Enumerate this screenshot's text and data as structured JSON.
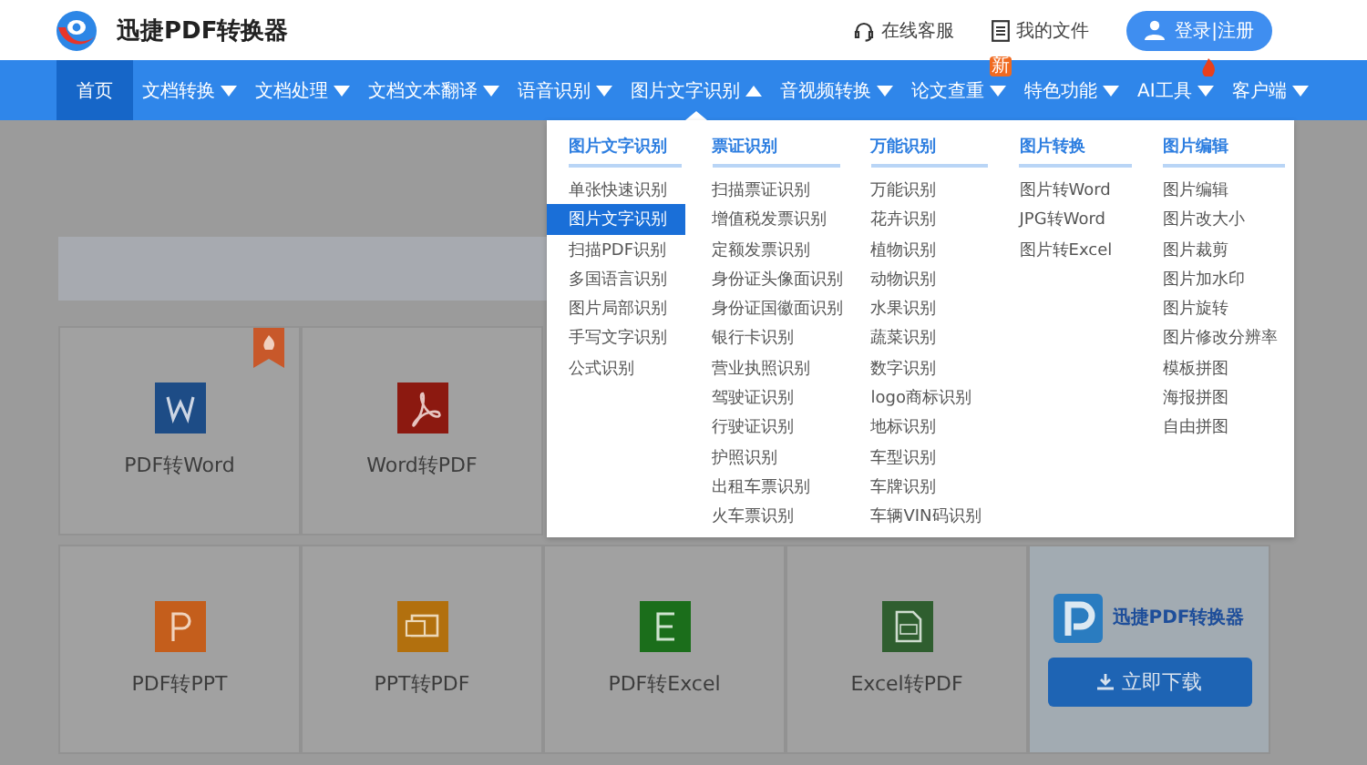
{
  "header": {
    "brand": "迅捷PDF转换器",
    "links": [
      {
        "kind": "service",
        "label": "在线客服"
      },
      {
        "kind": "files",
        "label": "我的文件"
      }
    ],
    "login": "登录|注册"
  },
  "nav": {
    "items": [
      {
        "label": "首页",
        "selected": true,
        "kind": "link",
        "expanded": false,
        "hot": false
      },
      {
        "label": "文档转换",
        "selected": false,
        "kind": "menu",
        "expanded": false,
        "hot": false
      },
      {
        "label": "文档处理",
        "selected": false,
        "kind": "menu",
        "expanded": false,
        "hot": false
      },
      {
        "label": "文档文本翻译",
        "selected": false,
        "kind": "menu",
        "expanded": false,
        "hot": false
      },
      {
        "label": "语音识别",
        "selected": false,
        "kind": "menu",
        "expanded": false,
        "hot": false
      },
      {
        "label": "图片文字识别",
        "selected": false,
        "kind": "menu",
        "expanded": true,
        "hot": false
      },
      {
        "label": "音视频转换",
        "selected": false,
        "kind": "menu",
        "expanded": false,
        "hot": false
      },
      {
        "label": "论文查重",
        "selected": false,
        "kind": "menu",
        "expanded": false,
        "hot": false,
        "badge": "新"
      },
      {
        "label": "特色功能",
        "selected": false,
        "kind": "menu",
        "expanded": false,
        "hot": false
      },
      {
        "label": "AI工具",
        "selected": false,
        "kind": "menu",
        "expanded": false,
        "hot": true
      },
      {
        "label": "客户端",
        "selected": false,
        "kind": "menu",
        "expanded": false,
        "hot": false
      }
    ]
  },
  "dropdown": {
    "columns": [
      {
        "title": "图片文字识别",
        "items": [
          {
            "label": "单张快速识别",
            "selected": false
          },
          {
            "label": "图片文字识别",
            "selected": true
          },
          {
            "label": "扫描PDF识别",
            "selected": false
          },
          {
            "label": "多国语言识别",
            "selected": false
          },
          {
            "label": "图片局部识别",
            "selected": false
          },
          {
            "label": "手写文字识别",
            "selected": false
          },
          {
            "label": "公式识别",
            "selected": false
          }
        ]
      },
      {
        "title": "票证识别",
        "items": [
          {
            "label": "扫描票证识别",
            "selected": false
          },
          {
            "label": "增值税发票识别",
            "selected": false
          },
          {
            "label": "定额发票识别",
            "selected": false
          },
          {
            "label": "身份证头像面识别",
            "selected": false
          },
          {
            "label": "身份证国徽面识别",
            "selected": false
          },
          {
            "label": "银行卡识别",
            "selected": false
          },
          {
            "label": "营业执照识别",
            "selected": false
          },
          {
            "label": "驾驶证识别",
            "selected": false
          },
          {
            "label": "行驶证识别",
            "selected": false
          },
          {
            "label": "护照识别",
            "selected": false
          },
          {
            "label": "出租车票识别",
            "selected": false
          },
          {
            "label": "火车票识别",
            "selected": false
          }
        ]
      },
      {
        "title": "万能识别",
        "items": [
          {
            "label": "万能识别",
            "selected": false
          },
          {
            "label": "花卉识别",
            "selected": false
          },
          {
            "label": "植物识别",
            "selected": false
          },
          {
            "label": "动物识别",
            "selected": false
          },
          {
            "label": "水果识别",
            "selected": false
          },
          {
            "label": "蔬菜识别",
            "selected": false
          },
          {
            "label": "数字识别",
            "selected": false
          },
          {
            "label": "logo商标识别",
            "selected": false
          },
          {
            "label": "地标识别",
            "selected": false
          },
          {
            "label": "车型识别",
            "selected": false
          },
          {
            "label": "车牌识别",
            "selected": false
          },
          {
            "label": "车辆VIN码识别",
            "selected": false
          }
        ]
      },
      {
        "title": "图片转换",
        "items": [
          {
            "label": "图片转Word",
            "selected": false
          },
          {
            "label": "JPG转Word",
            "selected": false
          },
          {
            "label": "图片转Excel",
            "selected": false
          }
        ]
      },
      {
        "title": "图片编辑",
        "items": [
          {
            "label": "图片编辑",
            "selected": false
          },
          {
            "label": "图片改大小",
            "selected": false
          },
          {
            "label": "图片裁剪",
            "selected": false
          },
          {
            "label": "图片加水印",
            "selected": false
          },
          {
            "label": "图片旋转",
            "selected": false
          },
          {
            "label": "图片修改分辨率",
            "selected": false
          },
          {
            "label": "模板拼图",
            "selected": false
          },
          {
            "label": "海报拼图",
            "selected": false
          },
          {
            "label": "自由拼图",
            "selected": false
          }
        ]
      }
    ]
  },
  "card_rows": [
    [
      {
        "kind": "word",
        "label": "PDF转Word",
        "hot": true
      },
      {
        "kind": "pdf",
        "label": "Word转PDF",
        "hot": false
      }
    ],
    [
      {
        "kind": "ppt",
        "label": "PDF转PPT",
        "hot": false
      },
      {
        "kind": "pptpdf",
        "label": "PPT转PDF",
        "hot": false
      },
      {
        "kind": "excel",
        "label": "PDF转Excel",
        "hot": false
      },
      {
        "kind": "excelpdf",
        "label": "Excel转PDF",
        "hot": false
      },
      {
        "kind": "promo",
        "brand": "迅捷PDF转换器",
        "button": "立即下载"
      }
    ]
  ]
}
